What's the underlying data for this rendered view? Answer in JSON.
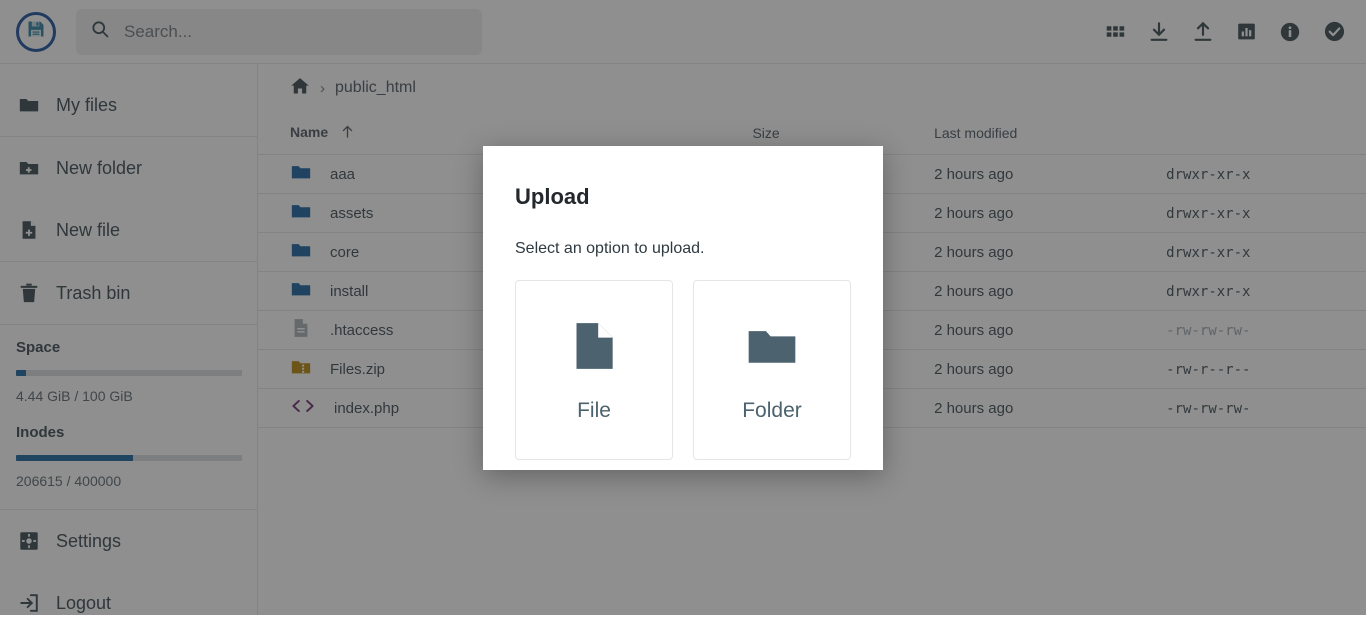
{
  "brand": {
    "logo_icon": "floppy-disk-save-icon",
    "logo_ring_color": "#1b4f9c",
    "logo_body_color": "#2f7fa3"
  },
  "topbar": {
    "search": {
      "icon": "search-icon",
      "placeholder": "Search...",
      "value": ""
    },
    "icons": [
      {
        "name": "grid-apps-icon",
        "label": "Apps"
      },
      {
        "name": "download-icon",
        "label": "Download"
      },
      {
        "name": "upload-icon",
        "label": "Upload"
      },
      {
        "name": "chart-stats-icon",
        "label": "Statistics"
      },
      {
        "name": "info-circle-icon",
        "label": "Info"
      },
      {
        "name": "check-circle-icon",
        "label": "Status"
      }
    ]
  },
  "sidebar": {
    "items": [
      {
        "label": "My files",
        "icon": "folder-icon"
      },
      {
        "label": "New folder",
        "icon": "folder-plus-icon"
      },
      {
        "label": "New file",
        "icon": "file-plus-icon"
      },
      {
        "label": "Trash bin",
        "icon": "trash-icon"
      }
    ],
    "footer_items": [
      {
        "label": "Settings",
        "icon": "gear-icon"
      },
      {
        "label": "Logout",
        "icon": "logout-icon"
      }
    ],
    "meters": [
      {
        "title": "Space",
        "label": "4.44 GiB / 100 GiB",
        "percent": 4.44,
        "fill_color": "#1565a0"
      },
      {
        "title": "Inodes",
        "label": "206615 / 400000",
        "percent": 51.7,
        "fill_color": "#1565a0"
      }
    ]
  },
  "breadcrumb": {
    "home_icon": "home-icon",
    "separator": "›",
    "current": "public_html"
  },
  "table": {
    "columns": {
      "name": "Name",
      "size": "Size",
      "modified": "Last modified",
      "permissions": ""
    },
    "sort": {
      "column": "Name",
      "direction": "asc",
      "icon": "arrow-up-icon"
    },
    "rows": [
      {
        "name": "aaa",
        "icon": "folder-icon",
        "size": "",
        "modified": "2 hours ago",
        "permissions": "drwxr-xr-x",
        "dimmed": false
      },
      {
        "name": "assets",
        "icon": "folder-icon",
        "size": "",
        "modified": "2 hours ago",
        "permissions": "drwxr-xr-x",
        "dimmed": false
      },
      {
        "name": "core",
        "icon": "folder-icon",
        "size": "",
        "modified": "2 hours ago",
        "permissions": "drwxr-xr-x",
        "dimmed": false
      },
      {
        "name": "install",
        "icon": "folder-icon",
        "size": "",
        "modified": "2 hours ago",
        "permissions": "drwxr-xr-x",
        "dimmed": false
      },
      {
        "name": ".htaccess",
        "icon": "file-text-icon",
        "size": "",
        "modified": "2 hours ago",
        "permissions": "-rw-rw-rw-",
        "dimmed": true
      },
      {
        "name": "Files.zip",
        "icon": "archive-icon",
        "size": "",
        "modified": "2 hours ago",
        "permissions": "-rw-r--r--",
        "dimmed": false
      },
      {
        "name": "index.php",
        "icon": "code-icon",
        "size": "",
        "modified": "2 hours ago",
        "permissions": "-rw-rw-rw-",
        "dimmed": false
      }
    ]
  },
  "modal": {
    "title": "Upload",
    "subtitle": "Select an option to upload.",
    "options": [
      {
        "label": "File",
        "icon": "file-icon"
      },
      {
        "label": "Folder",
        "icon": "folder-icon"
      }
    ]
  },
  "colors": {
    "folder_blue": "#1560a0",
    "archive_gold": "#b8860b",
    "code_purple": "#6d2a6d",
    "accent": "#1565a0",
    "icon_dark": "#37474f",
    "modal_icon": "#4c626e"
  }
}
